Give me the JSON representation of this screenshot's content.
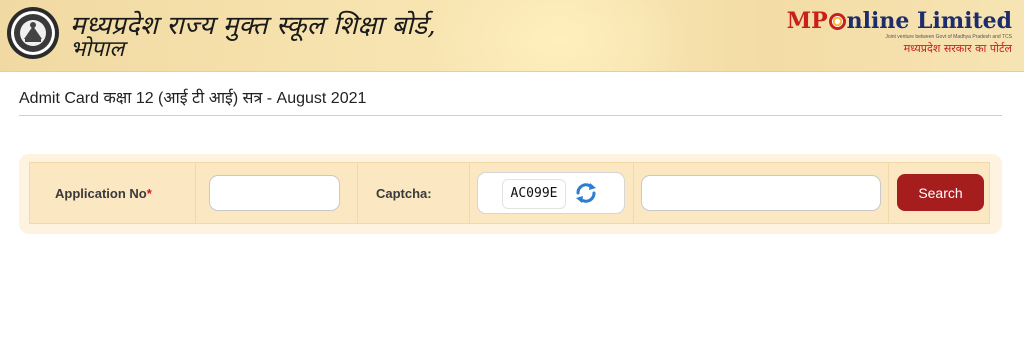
{
  "header": {
    "title_line1": "मध्यप्रदेश राज्य मुक्त स्कूल शिक्षा बोर्ड,",
    "title_line2": "भोपाल",
    "emblem_icon": "mp-state-open-school-emblem",
    "partner_logo": {
      "mp": "MP",
      "rest": "nline Limited",
      "tagline_en": "Joint venture between Govt of Madhya Pradesh and TCS",
      "tagline_hi": "मध्यप्रदेश सरकार का पोर्टल"
    }
  },
  "page": {
    "title": "Admit Card कक्षा 12 (आई टी आई) सत्र - August 2021"
  },
  "form": {
    "application_label": "Application No",
    "required_mark": "*",
    "application_value": "",
    "captcha_label": "Captcha:",
    "captcha_code": "AC099E",
    "captcha_input_value": "",
    "search_label": "Search",
    "refresh_icon": "refresh-icon"
  },
  "colors": {
    "header_bg": "#f6e2ad",
    "form_bg": "#fbe7c2",
    "search_button": "#a51d1d",
    "refresh_icon": "#2a7fd4",
    "logo_red": "#c8201c",
    "logo_blue": "#1d2c6b"
  }
}
